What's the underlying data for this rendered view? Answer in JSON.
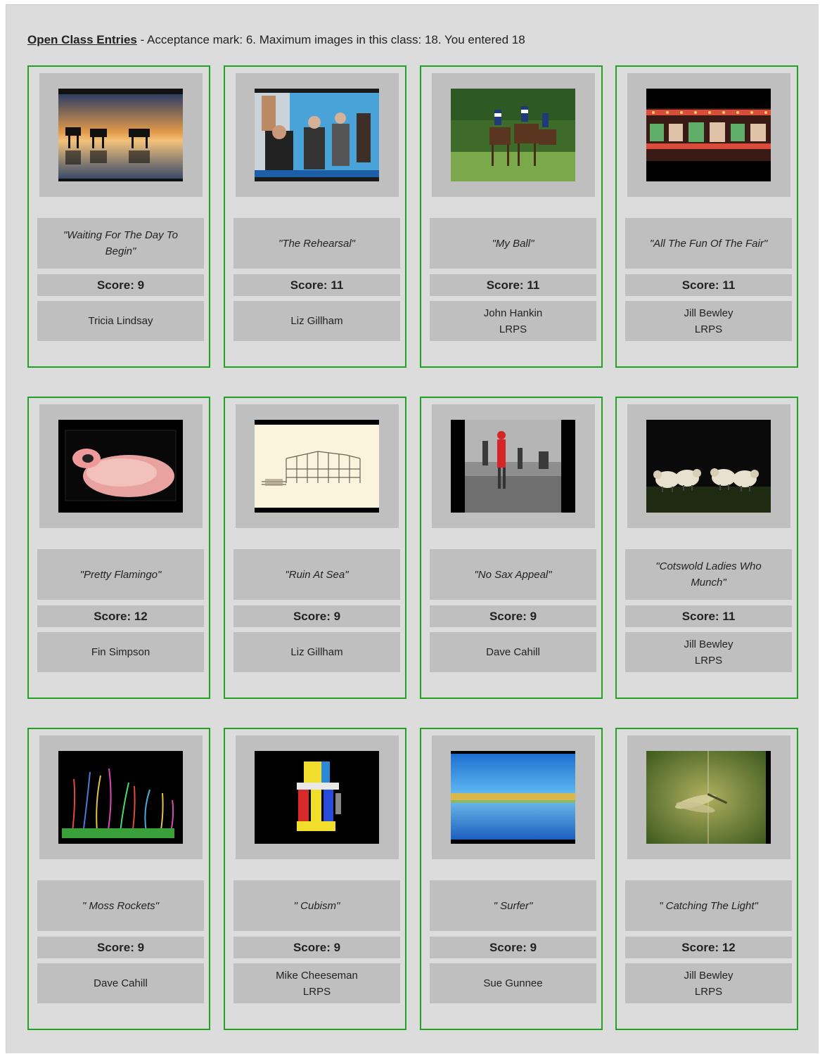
{
  "header": {
    "title": "Open Class Entries",
    "details": " - Acceptance mark: 6. Maximum images in this class: 18. You entered 18"
  },
  "colors": {
    "card_border": "#21a321",
    "panel": "#bfbfbf",
    "page": "#dcdcdc"
  },
  "entries": [
    {
      "title": "\"Waiting For The Day To Begin\"",
      "score": "Score: 9",
      "author": "Tricia Lindsay",
      "honours": "",
      "image": "horses-sunset"
    },
    {
      "title": "\"The Rehearsal\"",
      "score": "Score: 11",
      "author": "Liz Gillham",
      "honours": "",
      "image": "rehearsal"
    },
    {
      "title": "\"My Ball\"",
      "score": "Score: 11",
      "author": "John Hankin",
      "honours": "LRPS",
      "image": "polo"
    },
    {
      "title": "\"All The Fun Of The Fair\"",
      "score": "Score: 11",
      "author": "Jill Bewley",
      "honours": "LRPS",
      "image": "fairground"
    },
    {
      "title": "\"Pretty Flamingo\"",
      "score": "Score: 12",
      "author": "Fin Simpson",
      "honours": "",
      "image": "flamingo"
    },
    {
      "title": "\"Ruin At Sea\"",
      "score": "Score: 9",
      "author": "Liz Gillham",
      "honours": "",
      "image": "pier-ruin"
    },
    {
      "title": "\"No Sax Appeal\"",
      "score": "Score: 9",
      "author": "Dave Cahill",
      "honours": "",
      "image": "saxophonist"
    },
    {
      "title": "\"Cotswold Ladies Who Munch\"",
      "score": "Score: 11",
      "author": "Jill Bewley",
      "honours": "LRPS",
      "image": "sheep"
    },
    {
      "title": "\" Moss Rockets\"",
      "score": "Score: 9",
      "author": "Dave Cahill",
      "honours": "",
      "image": "moss"
    },
    {
      "title": "\" Cubism\"",
      "score": "Score: 9",
      "author": "Mike Cheeseman",
      "honours": "LRPS",
      "image": "cubism"
    },
    {
      "title": "\" Surfer\"",
      "score": "Score: 9",
      "author": "Sue Gunnee",
      "honours": "",
      "image": "seascape"
    },
    {
      "title": "\" Catching The Light\"",
      "score": "Score: 12",
      "author": "Jill Bewley",
      "honours": "LRPS",
      "image": "damselfly"
    }
  ]
}
